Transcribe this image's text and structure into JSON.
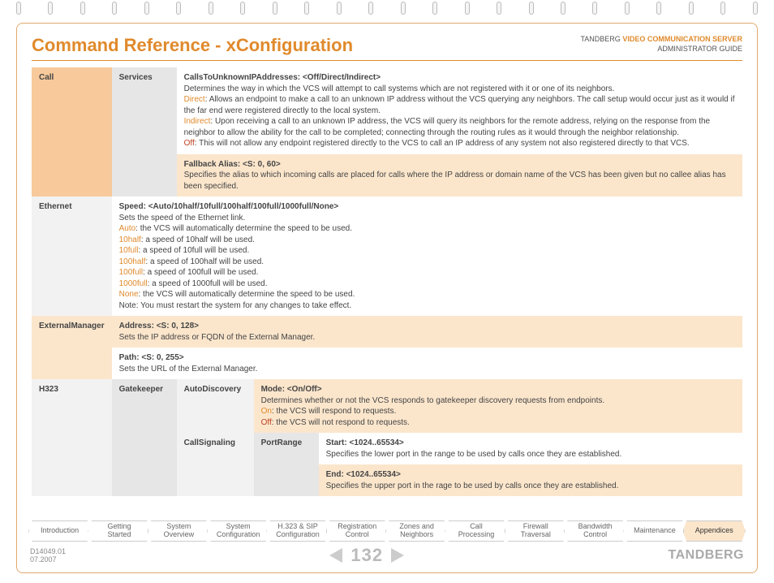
{
  "header": {
    "title": "Command Reference - xConfiguration",
    "brand": "TANDBERG",
    "product": "VIDEO COMMUNICATION SERVER",
    "subtitle": "ADMINISTRATOR GUIDE"
  },
  "sec_call": {
    "label": "Call",
    "svc": "Services",
    "r1_t": "CallsToUnknownIPAddresses: <Off/Direct/Indirect>",
    "r1_d": "Determines the way in which the VCS will attempt to call systems which are not registered with it or one of its neighbors.",
    "r1_direct_k": "Direct",
    "r1_direct": ": Allows an endpoint to make a call to an unknown IP address without the VCS querying any neighbors. The call setup would occur just as it would if the far end were registered directly to the local system.",
    "r1_indirect_k": "Indirect",
    "r1_indirect": ": Upon receiving a call to an unknown IP address, the VCS will query its neighbors for the remote address, relying on the response from the neighbor to allow the ability for the call to be completed; connecting through the routing rules as it would through the neighbor relationship.",
    "r1_off_k": "Off",
    "r1_off": ": This will not allow any endpoint registered directly to the VCS to call an IP address of any system not also registered directly to that VCS.",
    "r2_t": "Fallback Alias: <S: 0, 60>",
    "r2_d": "Specifies the alias to which incoming calls are placed for calls where the IP address or domain name of the VCS has been given but no callee alias has been specified."
  },
  "sec_eth": {
    "label": "Ethernet",
    "t": "Speed: <Auto/10half/10full/100half/100full/1000full/None>",
    "d0": "Sets the speed of the Ethernet link.",
    "k_auto": "Auto",
    "v_auto": ": the VCS will automatically determine the speed to be used.",
    "k_10h": "10half",
    "v_10h": ":  a speed of 10half will be used.",
    "k_10f": "10full",
    "v_10f": ": a speed of 10full will be used.",
    "k_100h": "100half",
    "v_100h": ": a speed of 100half will be used.",
    "k_100f": "100full",
    "v_100f": ": a speed of 100full will be used.",
    "k_1000f": "1000full",
    "v_1000f": ": a speed of 1000full will be used.",
    "k_none": "None",
    "v_none": ": the VCS will automatically determine the speed to be used.",
    "note": "Note: You must restart the system for any changes to take effect."
  },
  "sec_em": {
    "label": "ExternalManager",
    "r1_t": "Address: <S: 0, 128>",
    "r1_d": "Sets the IP address or FQDN of the External Manager.",
    "r2_t": "Path: <S: 0, 255>",
    "r2_d": "Sets the URL of the External Manager."
  },
  "sec_h323": {
    "label": "H323",
    "gk": "Gatekeeper",
    "auto": "AutoDiscovery",
    "auto_t": "Mode: <On/Off>",
    "auto_d": "Determines whether or not the VCS responds to gatekeeper discovery requests from endpoints.",
    "auto_on_k": "On",
    "auto_on": ": the VCS will respond to requests.",
    "auto_off_k": "Off",
    "auto_off": ": the VCS will not respond to requests.",
    "cs": "CallSignaling",
    "pr": "PortRange",
    "pr1_t": "Start: <1024..65534>",
    "pr1_d": "Specifies the lower port in the range to be used by calls once they are established.",
    "pr2_t": "End: <1024..65534>",
    "pr2_d": "Specifies the upper port in the rage to be used by calls once they are established."
  },
  "tabs": [
    "Introduction",
    "Getting\nStarted",
    "System\nOverview",
    "System\nConfiguration",
    "H.323 & SIP\nConfiguration",
    "Registration\nControl",
    "Zones and\nNeighbors",
    "Call\nProcessing",
    "Firewall\nTraversal",
    "Bandwidth\nControl",
    "Maintenance",
    "Appendices"
  ],
  "footer": {
    "doc": "D14049.01",
    "date": "07.2007",
    "page": "132",
    "brand": "TANDBERG"
  }
}
